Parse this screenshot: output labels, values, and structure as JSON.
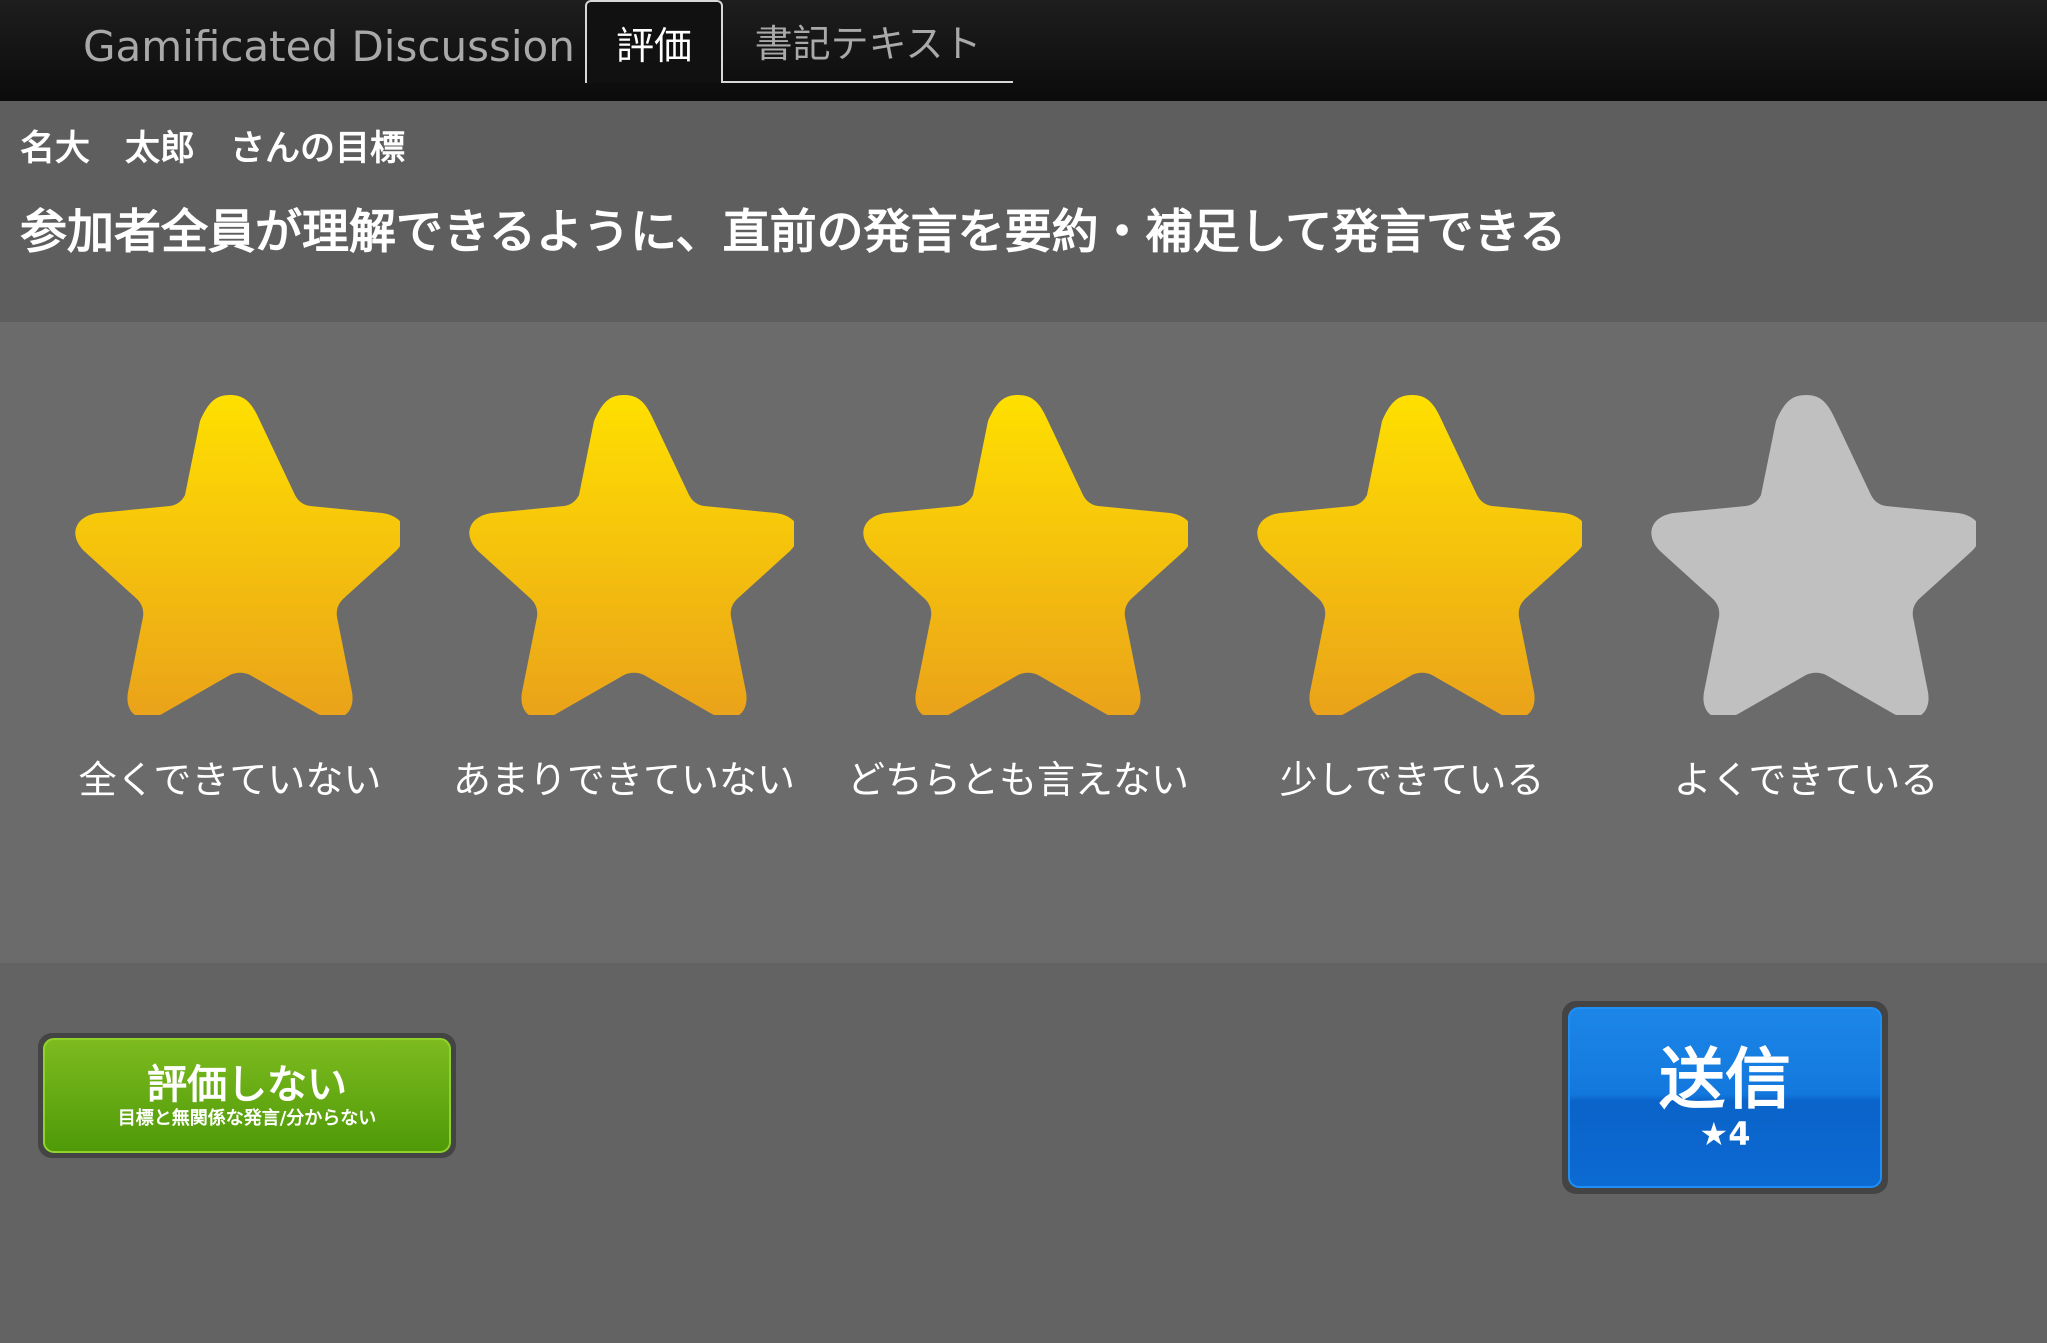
{
  "header": {
    "app_title": "Gamificated Discussion",
    "tabs": [
      {
        "label": "評価",
        "active": true
      },
      {
        "label": "書記テキスト",
        "active": false
      }
    ]
  },
  "goal": {
    "owner": "名大　太郎　さんの目標",
    "text": "参加者全員が理解できるように、直前の発言を要約・補足して発言できる"
  },
  "rating": {
    "value": 4,
    "max": 5,
    "options": [
      {
        "label": "全くできていない"
      },
      {
        "label": "あまりできていない"
      },
      {
        "label": "どちらとも言えない"
      },
      {
        "label": "少しできている"
      },
      {
        "label": "よくできている"
      }
    ],
    "colors": {
      "filled_top": "#ffe000",
      "filled_bottom": "#eaa21a",
      "empty": "#c0c0c0"
    }
  },
  "buttons": {
    "skip": {
      "label": "評価しない",
      "sublabel": "目標と無関係な発言/分からない"
    },
    "send": {
      "label": "送信",
      "sublabel": "★4"
    }
  }
}
